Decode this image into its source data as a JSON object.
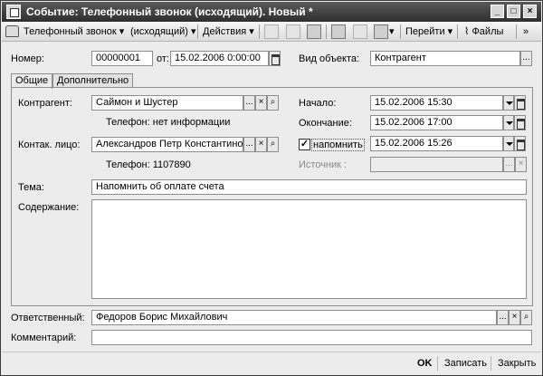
{
  "window": {
    "title": "Событие: Телефонный звонок (исходящий). Новый *",
    "buttons": {
      "minimize": "_",
      "maximize": "□",
      "close": "×"
    }
  },
  "toolbar": {
    "type_label": "Телефонный звонок",
    "direction_label": "(исходящий)",
    "actions_label": "Действия",
    "goto_label": "Перейти",
    "files_label": "Файлы"
  },
  "header": {
    "number_label": "Номер:",
    "number_value": "00000001",
    "date_label": "от:",
    "date_value": "15.02.2006  0:00:00",
    "object_type_label": "Вид объекта:",
    "object_type_value": "Контрагент"
  },
  "tabs": [
    {
      "label": "Общие"
    },
    {
      "label": "Дополнительно"
    }
  ],
  "main": {
    "counterparty_label": "Контрагент:",
    "counterparty_value": "Саймон и Шустер",
    "counterparty_phone": "Телефон: нет информации",
    "contact_label": "Контак. лицо:",
    "contact_value": "Александров Петр Константинови",
    "contact_phone": "Телефон: 1107890",
    "start_label": "Начало:",
    "start_value": "15.02.2006 15:30",
    "end_label": "Окончание:",
    "end_value": "15.02.2006 17:00",
    "remind_label": "напомнить",
    "remind_checked": true,
    "remind_value": "15.02.2006 15:26",
    "source_label": "Источник :",
    "source_value": "",
    "subject_label": "Тема:",
    "subject_value": "Напомнить об оплате счета",
    "content_label": "Содержание:",
    "content_value": ""
  },
  "footer": {
    "responsible_label": "Ответственный:",
    "responsible_value": "Федоров Борис Михайлович",
    "comment_label": "Комментарий:",
    "comment_value": ""
  },
  "statusbar": {
    "ok_label": "OK",
    "save_label": "Записать",
    "close_label": "Закрыть"
  },
  "glyphs": {
    "ellipsis": "...",
    "clear": "×",
    "search": "⌕",
    "check": "✓",
    "dropdown_arrow": "▾"
  }
}
